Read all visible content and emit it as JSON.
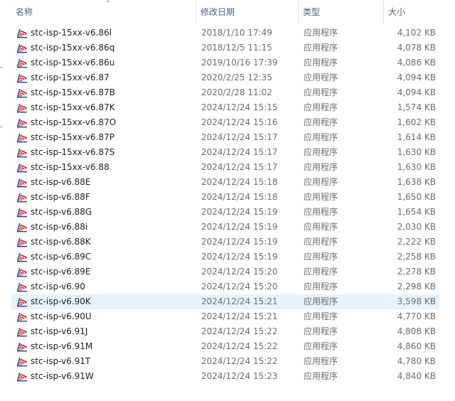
{
  "columns": {
    "name": "名称",
    "date": "修改日期",
    "type": "类型",
    "size": "大小"
  },
  "sort_indicator": "^",
  "icon_name": "stc-isp-app-icon",
  "colors": {
    "selected_row": "#e5f3ff",
    "header_text": "#4c607a",
    "icon_red": "#c0282d",
    "icon_blue": "#2d3a8c"
  },
  "selected_index": 18,
  "files": [
    {
      "name": "stc-isp-15xx-v6.86l",
      "date": "2018/1/10 17:49",
      "type": "应用程序",
      "size": "4,102 KB"
    },
    {
      "name": "stc-isp-15xx-v6.86q",
      "date": "2018/12/5 11:15",
      "type": "应用程序",
      "size": "4,078 KB"
    },
    {
      "name": "stc-isp-15xx-v6.86u",
      "date": "2019/10/16 17:39",
      "type": "应用程序",
      "size": "4,086 KB"
    },
    {
      "name": "stc-isp-15xx-v6.87",
      "date": "2020/2/25 12:35",
      "type": "应用程序",
      "size": "4,094 KB"
    },
    {
      "name": "stc-isp-15xx-v6.87B",
      "date": "2020/2/28 11:02",
      "type": "应用程序",
      "size": "4,094 KB"
    },
    {
      "name": "stc-isp-15xx-v6.87K",
      "date": "2024/12/24 15:15",
      "type": "应用程序",
      "size": "1,574 KB"
    },
    {
      "name": "stc-isp-15xx-v6.87O",
      "date": "2024/12/24 15:16",
      "type": "应用程序",
      "size": "1,602 KB"
    },
    {
      "name": "stc-isp-15xx-v6.87P",
      "date": "2024/12/24 15:17",
      "type": "应用程序",
      "size": "1,614 KB"
    },
    {
      "name": "stc-isp-15xx-v6.87S",
      "date": "2024/12/24 15:17",
      "type": "应用程序",
      "size": "1,630 KB"
    },
    {
      "name": "stc-isp-15xx-v6.88",
      "date": "2024/12/24 15:17",
      "type": "应用程序",
      "size": "1,630 KB"
    },
    {
      "name": "stc-isp-v6.88E",
      "date": "2024/12/24 15:18",
      "type": "应用程序",
      "size": "1,638 KB"
    },
    {
      "name": "stc-isp-v6.88F",
      "date": "2024/12/24 15:18",
      "type": "应用程序",
      "size": "1,650 KB"
    },
    {
      "name": "stc-isp-v6.88G",
      "date": "2024/12/24 15:19",
      "type": "应用程序",
      "size": "1,654 KB"
    },
    {
      "name": "stc-isp-v6.88i",
      "date": "2024/12/24 15:19",
      "type": "应用程序",
      "size": "2,030 KB"
    },
    {
      "name": "stc-isp-v6.88K",
      "date": "2024/12/24 15:19",
      "type": "应用程序",
      "size": "2,222 KB"
    },
    {
      "name": "stc-isp-v6.89C",
      "date": "2024/12/24 15:19",
      "type": "应用程序",
      "size": "2,258 KB"
    },
    {
      "name": "stc-isp-v6.89E",
      "date": "2024/12/24 15:20",
      "type": "应用程序",
      "size": "2,278 KB"
    },
    {
      "name": "stc-isp-v6.90",
      "date": "2024/12/24 15:20",
      "type": "应用程序",
      "size": "2,298 KB"
    },
    {
      "name": "stc-isp-v6.90K",
      "date": "2024/12/24 15:21",
      "type": "应用程序",
      "size": "3,598 KB"
    },
    {
      "name": "stc-isp-v6.90U",
      "date": "2024/12/24 15:21",
      "type": "应用程序",
      "size": "4,770 KB"
    },
    {
      "name": "stc-isp-v6.91J",
      "date": "2024/12/24 15:22",
      "type": "应用程序",
      "size": "4,808 KB"
    },
    {
      "name": "stc-isp-v6.91M",
      "date": "2024/12/24 15:22",
      "type": "应用程序",
      "size": "4,860 KB"
    },
    {
      "name": "stc-isp-v6.91T",
      "date": "2024/12/24 15:22",
      "type": "应用程序",
      "size": "4,780 KB"
    },
    {
      "name": "stc-isp-v6.91W",
      "date": "2024/12/24 15:23",
      "type": "应用程序",
      "size": "4,840 KB"
    }
  ]
}
